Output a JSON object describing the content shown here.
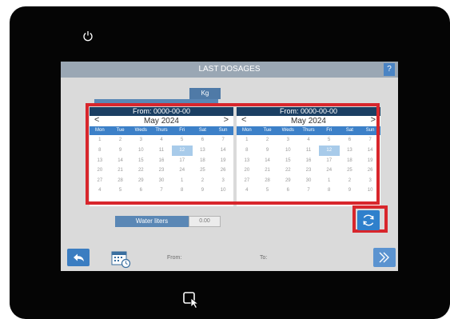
{
  "screen": {
    "title": "LAST DOSAGES",
    "help_label": "?",
    "kg_label": "Kg",
    "water_label": "Water liters",
    "water_value": "0.00",
    "from_label": "From:",
    "to_label": "To:"
  },
  "calendars": [
    {
      "header": "From: 0000-00-00",
      "prev": "<",
      "next": ">",
      "month": "May 2024",
      "weekdays": [
        "Mon",
        "Tue",
        "Weds",
        "Thurs",
        "Fri",
        "Sat",
        "Sun"
      ],
      "selected": "12",
      "weeks": [
        [
          "1",
          "2",
          "3",
          "4",
          "5",
          "6",
          "7"
        ],
        [
          "8",
          "9",
          "10",
          "11",
          "12",
          "13",
          "14"
        ],
        [
          "13",
          "14",
          "15",
          "16",
          "17",
          "18",
          "19"
        ],
        [
          "20",
          "21",
          "22",
          "23",
          "24",
          "25",
          "26"
        ],
        [
          "27",
          "28",
          "29",
          "30",
          "1",
          "2",
          "3"
        ],
        [
          "4",
          "5",
          "6",
          "7",
          "8",
          "9",
          "10"
        ]
      ]
    },
    {
      "header": "From: 0000-00-00",
      "prev": "<",
      "next": ">",
      "month": "May 2024",
      "weekdays": [
        "Mon",
        "Tue",
        "Weds",
        "Thurs",
        "Fri",
        "Sat",
        "Sun"
      ],
      "selected": "12",
      "weeks": [
        [
          "1",
          "2",
          "3",
          "4",
          "5",
          "6",
          "7"
        ],
        [
          "8",
          "9",
          "10",
          "11",
          "12",
          "13",
          "14"
        ],
        [
          "13",
          "14",
          "15",
          "16",
          "17",
          "18",
          "19"
        ],
        [
          "20",
          "21",
          "22",
          "23",
          "24",
          "25",
          "26"
        ],
        [
          "27",
          "28",
          "29",
          "30",
          "1",
          "2",
          "3"
        ],
        [
          "4",
          "5",
          "6",
          "7",
          "8",
          "9",
          "10"
        ]
      ]
    }
  ],
  "icons": {
    "power": "power-icon",
    "back": "back-arrow-icon",
    "calendar": "calendar-clock-icon",
    "next": "double-chevron-right-icon",
    "refresh": "refresh-icon",
    "tap": "tap-pointer-icon"
  },
  "colors": {
    "highlight": "#d8262c",
    "accent": "#3c80c8",
    "header_dark": "#1b3f63",
    "selected_day": "#a8cbea"
  }
}
